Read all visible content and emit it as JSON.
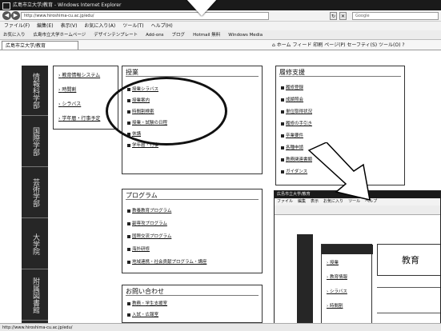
{
  "window": {
    "title": "広島市立大学/教育 - Windows Internet Explorer"
  },
  "toolbar": {
    "url": "http://www.hiroshima-cu.ac.jp/edu/",
    "search_placeholder": "Google",
    "back_icon": "back-arrow-icon",
    "forward_icon": "forward-arrow-icon"
  },
  "menu": {
    "items": [
      "ファイル(F)",
      "編集(E)",
      "表示(V)",
      "お気に入り(A)",
      "ツール(T)",
      "ヘルプ(H)"
    ]
  },
  "favorites": {
    "items": [
      "お気に入り",
      "広島市立大学ホームページ",
      "デザインテンプレート",
      "Add-ons",
      "ブログ",
      "Hotmail 無料",
      "Windows Media"
    ]
  },
  "tab": {
    "label": "広島市立大学/教育",
    "tools": [
      "ホーム",
      "フィード",
      "印刷",
      "ページ(P)",
      "セーフティ(S)",
      "ツール(O)",
      "ヘルプ"
    ]
  },
  "sidenav": {
    "items": [
      "情報科学部",
      "国際学部",
      "芸術学部",
      "大学院",
      "附属図書館"
    ]
  },
  "subnav": {
    "items": [
      "教育情報システム",
      "時間割",
      "シラバス",
      "学年暦・行事予定"
    ]
  },
  "education": {
    "title": "授業",
    "links": [
      "授業シラバス",
      "授業案内",
      "時間割検索",
      "授業・試験の日程",
      "休講",
      "学年暦・行事"
    ]
  },
  "results": {
    "title": "履修支援",
    "links": [
      "履修登録",
      "成績照会",
      "単位取得状況",
      "履修の手引き",
      "卒業要件",
      "各種申請",
      "教務関連書類",
      "ガイダンス"
    ]
  },
  "program": {
    "title": "プログラム",
    "links": [
      "教養教育プログラム",
      "副専攻プログラム",
      "国際交流プログラム",
      "海外研修",
      "地域連携・社会貢献プログラム・講座"
    ]
  },
  "contact": {
    "title": "お問い合わせ",
    "links": [
      "教務・学生支援室",
      "入試・広報室"
    ]
  },
  "inset": {
    "title": "広島市立大学/教育",
    "menu": [
      "ファイル",
      "編集",
      "表示",
      "お気に入り",
      "ツール",
      "ヘルプ"
    ],
    "heading": "教育",
    "nav": [
      "授業",
      "教育情報",
      "シラバス",
      "時間割"
    ]
  },
  "status": {
    "text": "http://www.hiroshima-cu.ac.jp/edu/"
  }
}
